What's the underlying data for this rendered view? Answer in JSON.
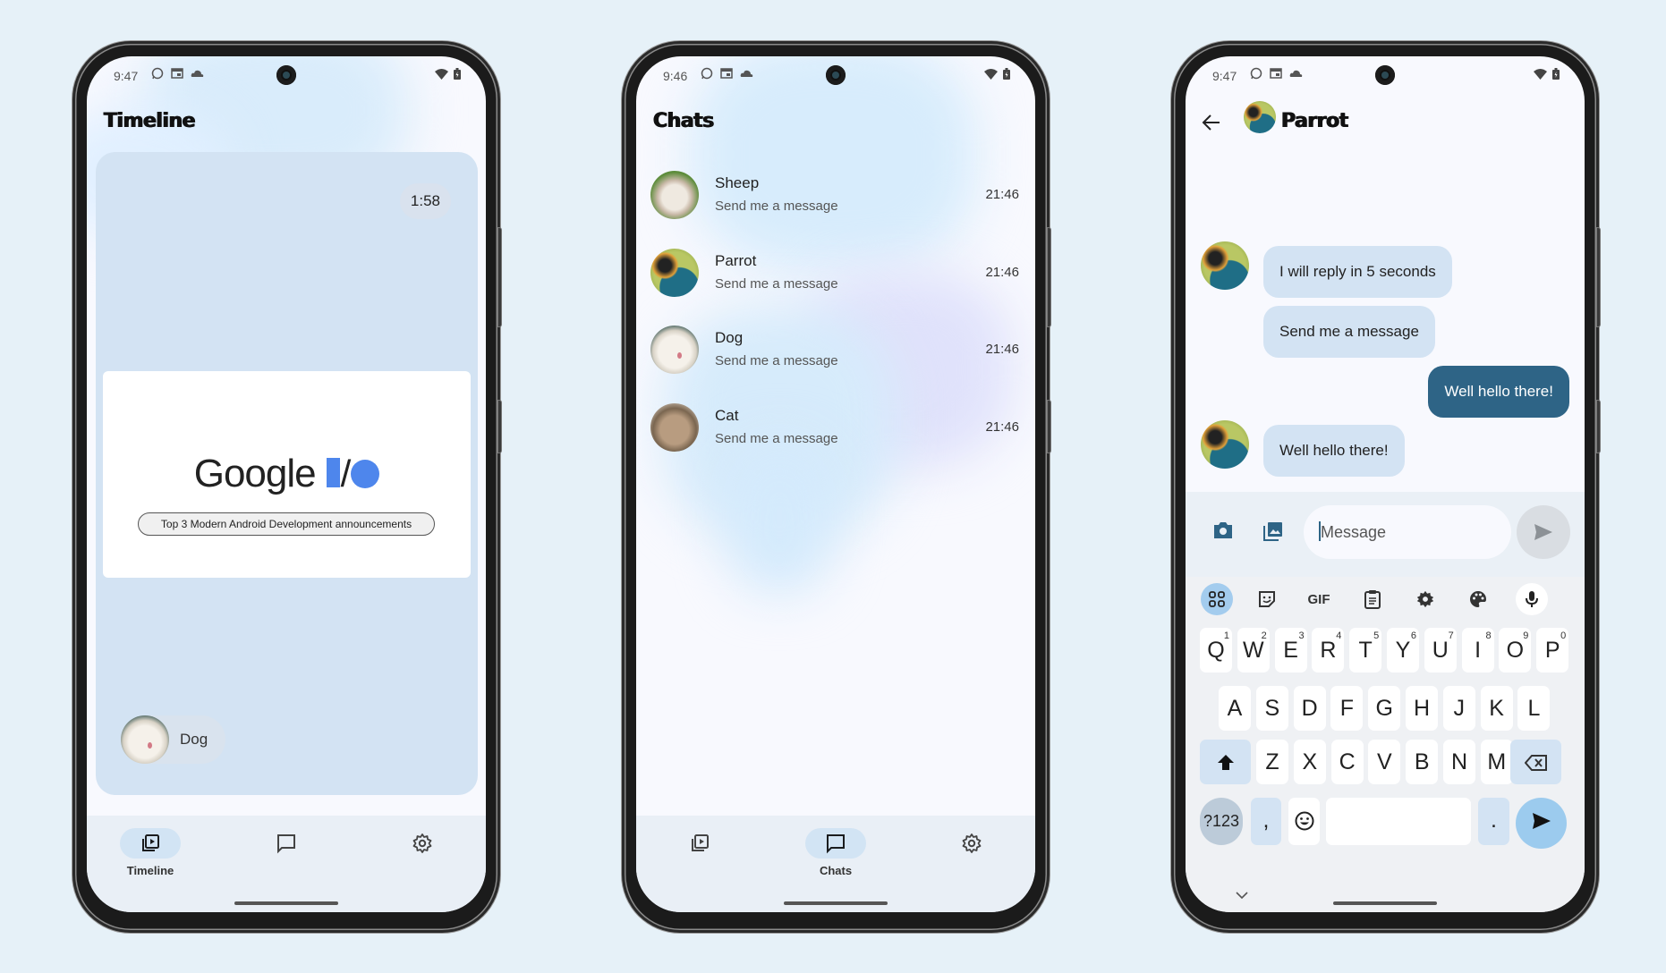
{
  "phones": [
    {
      "status": {
        "time": "9:47",
        "icons": [
          "whatsapp-icon",
          "news-icon",
          "cloud-icon"
        ],
        "right_icons": [
          "wifi-icon",
          "battery-charging-icon"
        ]
      },
      "title": "Timeline",
      "video": {
        "duration": "1:58",
        "thumbnail_title": "Google",
        "thumbnail_caption": "Top 3 Modern Android Development announcements",
        "author": "Dog"
      },
      "nav": [
        {
          "label": "Timeline",
          "icon": "video-library-icon",
          "active": true
        },
        {
          "label": "Chats",
          "icon": "chat-icon",
          "active": false
        },
        {
          "label": "Settings",
          "icon": "settings-icon",
          "active": false
        }
      ]
    },
    {
      "status": {
        "time": "9:46",
        "icons": [
          "whatsapp-icon",
          "news-icon",
          "cloud-icon"
        ],
        "right_icons": [
          "wifi-icon",
          "battery-charging-icon"
        ]
      },
      "title": "Chats",
      "chats": [
        {
          "name": "Sheep",
          "message": "Send me a message",
          "time": "21:46"
        },
        {
          "name": "Parrot",
          "message": "Send me a message",
          "time": "21:46"
        },
        {
          "name": "Dog",
          "message": "Send me a message",
          "time": "21:46"
        },
        {
          "name": "Cat",
          "message": "Send me a message",
          "time": "21:46"
        }
      ],
      "nav": [
        {
          "label": "Timeline",
          "icon": "video-library-icon",
          "active": false
        },
        {
          "label": "Chats",
          "icon": "chat-icon",
          "active": true
        },
        {
          "label": "Settings",
          "icon": "settings-icon",
          "active": false
        }
      ]
    },
    {
      "status": {
        "time": "9:47",
        "icons": [
          "whatsapp-icon",
          "news-icon",
          "cloud-icon"
        ],
        "right_icons": [
          "wifi-icon",
          "battery-charging-icon"
        ]
      },
      "title": "Parrot",
      "messages": [
        {
          "text": "I will reply in 5 seconds",
          "from": "Parrot",
          "show_avatar": true
        },
        {
          "text": "Send me a message",
          "from": "Parrot",
          "show_avatar": false
        },
        {
          "text": "Well hello there!",
          "from": "me",
          "show_avatar": false
        },
        {
          "text": "Well hello there!",
          "from": "Parrot",
          "show_avatar": true
        }
      ],
      "input": {
        "placeholder": "Message",
        "value": ""
      },
      "keyboard": {
        "toolbar": [
          "apps-icon",
          "sticker-icon",
          "GIF",
          "clipboard-icon",
          "settings-icon",
          "palette-icon",
          "mic-icon"
        ],
        "row1": [
          "Q",
          "W",
          "E",
          "R",
          "T",
          "Y",
          "U",
          "I",
          "O",
          "P"
        ],
        "row1_hints": [
          "1",
          "2",
          "3",
          "4",
          "5",
          "6",
          "7",
          "8",
          "9",
          "0"
        ],
        "row2": [
          "A",
          "S",
          "D",
          "F",
          "G",
          "H",
          "J",
          "K",
          "L"
        ],
        "row3": [
          "Z",
          "X",
          "C",
          "V",
          "B",
          "N",
          "M"
        ],
        "symbols_label": "?123",
        "comma": ",",
        "period": "."
      }
    }
  ],
  "colors": {
    "background": "#e6f1f8",
    "card": "#d3e3f3",
    "sent_bubble": "#2e6486",
    "io_blue": "#4e86ec"
  }
}
